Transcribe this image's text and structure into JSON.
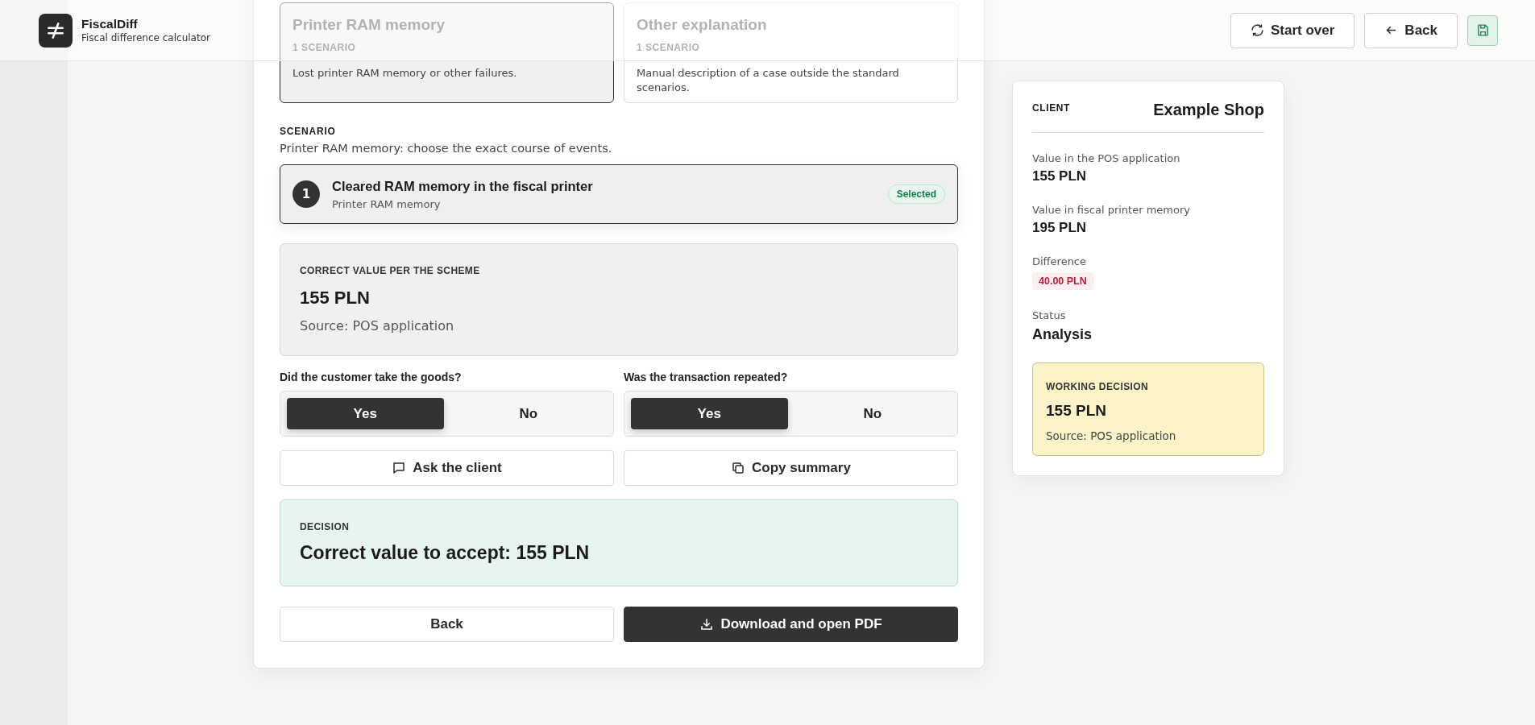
{
  "header": {
    "app_name": "FiscalDiff",
    "app_subtitle": "Fiscal difference calculator",
    "actions": [
      {
        "kind": "restart",
        "label": "Start over"
      },
      {
        "kind": "back",
        "label": "Back"
      },
      {
        "kind": "save"
      }
    ]
  },
  "categories": [
    {
      "title": "Printer RAM memory",
      "count": "1 SCENARIO",
      "description": "Lost printer RAM memory or other failures.",
      "selected": true
    },
    {
      "title": "Other explanation",
      "count": "1 SCENARIO",
      "description": "Manual description of a case outside the standard scenarios.",
      "selected": false
    }
  ],
  "scenario": {
    "heading": "SCENARIO",
    "hint": "Printer RAM memory: choose the exact course of events.",
    "options": [
      {
        "number": "1",
        "title": "Cleared RAM memory in the fiscal printer",
        "subtitle": "Printer RAM memory",
        "badge": "Selected",
        "selected": true
      }
    ]
  },
  "correct_value": {
    "label": "CORRECT VALUE PER THE SCHEME",
    "value": "155 PLN",
    "source": "Source: POS application"
  },
  "questions": [
    {
      "label": "Did the customer take the goods?",
      "options": [
        {
          "label": "Yes",
          "selected": true
        },
        {
          "label": "No",
          "selected": false
        }
      ]
    },
    {
      "label": "Was the transaction repeated?",
      "options": [
        {
          "label": "Yes",
          "selected": true
        },
        {
          "label": "No",
          "selected": false
        }
      ]
    }
  ],
  "actions": [
    {
      "kind": "ask",
      "label": "Ask the client"
    },
    {
      "kind": "copy",
      "label": "Copy summary"
    }
  ],
  "decision": {
    "label": "DECISION",
    "text": "Correct value to accept: 155 PLN"
  },
  "footer_buttons": [
    {
      "kind": "secondary",
      "label": "Back"
    },
    {
      "kind": "download",
      "label": "Download and open PDF"
    }
  ],
  "summary": {
    "client_label": "CLIENT",
    "client_name": "Example Shop",
    "fields": [
      {
        "kind": "amount",
        "label": "Value in the POS application",
        "value": "155 PLN"
      },
      {
        "kind": "amount",
        "label": "Value in fiscal printer memory",
        "value": "195 PLN"
      },
      {
        "kind": "badge",
        "label": "Difference",
        "value": "40.00 PLN"
      },
      {
        "kind": "status",
        "label": "Status",
        "value": "Analysis"
      }
    ],
    "working_decision": {
      "label": "WORKING DECISION",
      "value": "155 PLN",
      "source": "Source: POS application"
    }
  }
}
